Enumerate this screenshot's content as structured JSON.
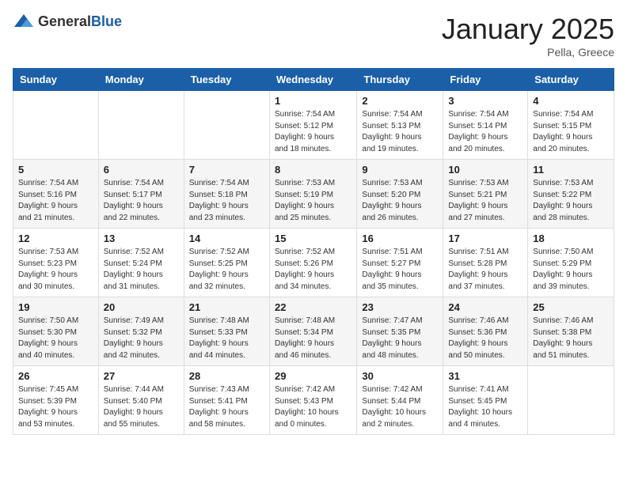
{
  "header": {
    "logo_general": "General",
    "logo_blue": "Blue",
    "month_title": "January 2025",
    "location": "Pella, Greece"
  },
  "weekdays": [
    "Sunday",
    "Monday",
    "Tuesday",
    "Wednesday",
    "Thursday",
    "Friday",
    "Saturday"
  ],
  "weeks": [
    [
      {
        "day": "",
        "info": ""
      },
      {
        "day": "",
        "info": ""
      },
      {
        "day": "",
        "info": ""
      },
      {
        "day": "1",
        "info": "Sunrise: 7:54 AM\nSunset: 5:12 PM\nDaylight: 9 hours\nand 18 minutes."
      },
      {
        "day": "2",
        "info": "Sunrise: 7:54 AM\nSunset: 5:13 PM\nDaylight: 9 hours\nand 19 minutes."
      },
      {
        "day": "3",
        "info": "Sunrise: 7:54 AM\nSunset: 5:14 PM\nDaylight: 9 hours\nand 20 minutes."
      },
      {
        "day": "4",
        "info": "Sunrise: 7:54 AM\nSunset: 5:15 PM\nDaylight: 9 hours\nand 20 minutes."
      }
    ],
    [
      {
        "day": "5",
        "info": "Sunrise: 7:54 AM\nSunset: 5:16 PM\nDaylight: 9 hours\nand 21 minutes."
      },
      {
        "day": "6",
        "info": "Sunrise: 7:54 AM\nSunset: 5:17 PM\nDaylight: 9 hours\nand 22 minutes."
      },
      {
        "day": "7",
        "info": "Sunrise: 7:54 AM\nSunset: 5:18 PM\nDaylight: 9 hours\nand 23 minutes."
      },
      {
        "day": "8",
        "info": "Sunrise: 7:53 AM\nSunset: 5:19 PM\nDaylight: 9 hours\nand 25 minutes."
      },
      {
        "day": "9",
        "info": "Sunrise: 7:53 AM\nSunset: 5:20 PM\nDaylight: 9 hours\nand 26 minutes."
      },
      {
        "day": "10",
        "info": "Sunrise: 7:53 AM\nSunset: 5:21 PM\nDaylight: 9 hours\nand 27 minutes."
      },
      {
        "day": "11",
        "info": "Sunrise: 7:53 AM\nSunset: 5:22 PM\nDaylight: 9 hours\nand 28 minutes."
      }
    ],
    [
      {
        "day": "12",
        "info": "Sunrise: 7:53 AM\nSunset: 5:23 PM\nDaylight: 9 hours\nand 30 minutes."
      },
      {
        "day": "13",
        "info": "Sunrise: 7:52 AM\nSunset: 5:24 PM\nDaylight: 9 hours\nand 31 minutes."
      },
      {
        "day": "14",
        "info": "Sunrise: 7:52 AM\nSunset: 5:25 PM\nDaylight: 9 hours\nand 32 minutes."
      },
      {
        "day": "15",
        "info": "Sunrise: 7:52 AM\nSunset: 5:26 PM\nDaylight: 9 hours\nand 34 minutes."
      },
      {
        "day": "16",
        "info": "Sunrise: 7:51 AM\nSunset: 5:27 PM\nDaylight: 9 hours\nand 35 minutes."
      },
      {
        "day": "17",
        "info": "Sunrise: 7:51 AM\nSunset: 5:28 PM\nDaylight: 9 hours\nand 37 minutes."
      },
      {
        "day": "18",
        "info": "Sunrise: 7:50 AM\nSunset: 5:29 PM\nDaylight: 9 hours\nand 39 minutes."
      }
    ],
    [
      {
        "day": "19",
        "info": "Sunrise: 7:50 AM\nSunset: 5:30 PM\nDaylight: 9 hours\nand 40 minutes."
      },
      {
        "day": "20",
        "info": "Sunrise: 7:49 AM\nSunset: 5:32 PM\nDaylight: 9 hours\nand 42 minutes."
      },
      {
        "day": "21",
        "info": "Sunrise: 7:48 AM\nSunset: 5:33 PM\nDaylight: 9 hours\nand 44 minutes."
      },
      {
        "day": "22",
        "info": "Sunrise: 7:48 AM\nSunset: 5:34 PM\nDaylight: 9 hours\nand 46 minutes."
      },
      {
        "day": "23",
        "info": "Sunrise: 7:47 AM\nSunset: 5:35 PM\nDaylight: 9 hours\nand 48 minutes."
      },
      {
        "day": "24",
        "info": "Sunrise: 7:46 AM\nSunset: 5:36 PM\nDaylight: 9 hours\nand 50 minutes."
      },
      {
        "day": "25",
        "info": "Sunrise: 7:46 AM\nSunset: 5:38 PM\nDaylight: 9 hours\nand 51 minutes."
      }
    ],
    [
      {
        "day": "26",
        "info": "Sunrise: 7:45 AM\nSunset: 5:39 PM\nDaylight: 9 hours\nand 53 minutes."
      },
      {
        "day": "27",
        "info": "Sunrise: 7:44 AM\nSunset: 5:40 PM\nDaylight: 9 hours\nand 55 minutes."
      },
      {
        "day": "28",
        "info": "Sunrise: 7:43 AM\nSunset: 5:41 PM\nDaylight: 9 hours\nand 58 minutes."
      },
      {
        "day": "29",
        "info": "Sunrise: 7:42 AM\nSunset: 5:43 PM\nDaylight: 10 hours\nand 0 minutes."
      },
      {
        "day": "30",
        "info": "Sunrise: 7:42 AM\nSunset: 5:44 PM\nDaylight: 10 hours\nand 2 minutes."
      },
      {
        "day": "31",
        "info": "Sunrise: 7:41 AM\nSunset: 5:45 PM\nDaylight: 10 hours\nand 4 minutes."
      },
      {
        "day": "",
        "info": ""
      }
    ]
  ]
}
